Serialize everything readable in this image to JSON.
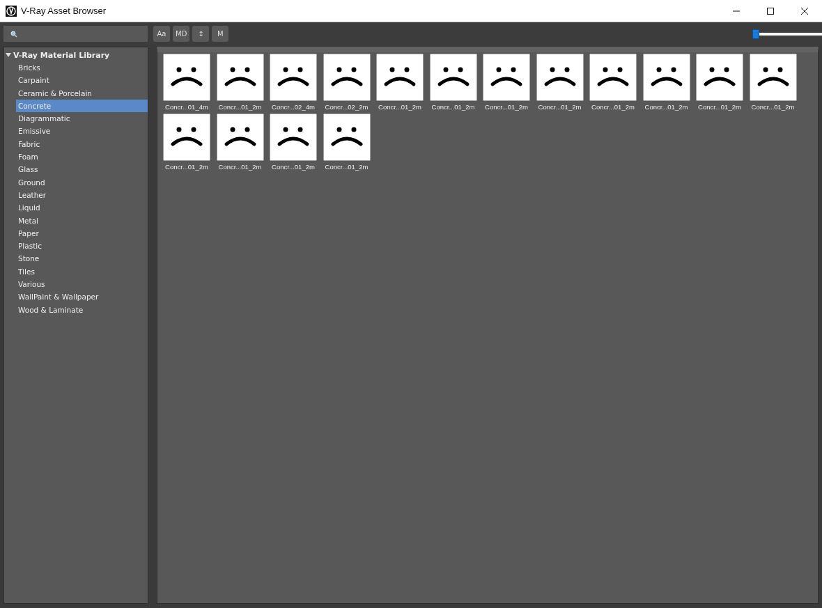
{
  "window": {
    "title": "V-Ray Asset Browser"
  },
  "toolbar": {
    "buttons": [
      {
        "label": "Aa"
      },
      {
        "label": "MD"
      },
      {
        "label": "↕"
      },
      {
        "label": "M"
      }
    ],
    "size_slider": {
      "level": 0
    }
  },
  "sidebar": {
    "root": {
      "label": "V-Ray Material Library",
      "expanded": true,
      "children": [
        {
          "label": "Bricks",
          "selected": false
        },
        {
          "label": "Carpaint",
          "selected": false
        },
        {
          "label": "Ceramic & Porcelain",
          "selected": false
        },
        {
          "label": "Concrete",
          "selected": true
        },
        {
          "label": "Diagrammatic",
          "selected": false
        },
        {
          "label": "Emissive",
          "selected": false
        },
        {
          "label": "Fabric",
          "selected": false
        },
        {
          "label": "Foam",
          "selected": false
        },
        {
          "label": "Glass",
          "selected": false
        },
        {
          "label": "Ground",
          "selected": false
        },
        {
          "label": "Leather",
          "selected": false
        },
        {
          "label": "Liquid",
          "selected": false
        },
        {
          "label": "Metal",
          "selected": false
        },
        {
          "label": "Paper",
          "selected": false
        },
        {
          "label": "Plastic",
          "selected": false
        },
        {
          "label": "Stone",
          "selected": false
        },
        {
          "label": "Tiles",
          "selected": false
        },
        {
          "label": "Various",
          "selected": false
        },
        {
          "label": "WallPaint & Wallpaper",
          "selected": false
        },
        {
          "label": "Wood & Laminate",
          "selected": false
        }
      ]
    }
  },
  "assets": [
    {
      "label": "Concr...01_4m"
    },
    {
      "label": "Concr...01_2m"
    },
    {
      "label": "Concr...02_4m"
    },
    {
      "label": "Concr...02_2m"
    },
    {
      "label": "Concr...01_2m"
    },
    {
      "label": "Concr...01_2m"
    },
    {
      "label": "Concr...01_2m"
    },
    {
      "label": "Concr...01_2m"
    },
    {
      "label": "Concr...01_2m"
    },
    {
      "label": "Concr...01_2m"
    },
    {
      "label": "Concr...01_2m"
    },
    {
      "label": "Concr...01_2m"
    },
    {
      "label": "Concr...01_2m"
    },
    {
      "label": "Concr...01_2m"
    },
    {
      "label": "Concr...01_2m"
    },
    {
      "label": "Concr...01_2m"
    }
  ]
}
